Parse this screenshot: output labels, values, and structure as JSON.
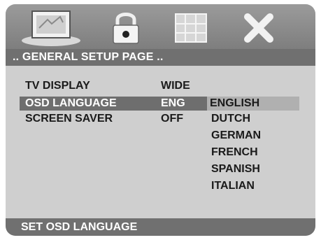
{
  "header": {
    "title": ".. GENERAL SETUP PAGE .."
  },
  "menu": {
    "items": [
      {
        "label": "TV DISPLAY",
        "value": "WIDE"
      },
      {
        "label": "OSD LANGUAGE",
        "value": "ENG"
      },
      {
        "label": "SCREEN SAVER",
        "value": "OFF"
      }
    ],
    "options": [
      "ENGLISH",
      "DUTCH",
      "GERMAN",
      "FRENCH",
      "SPANISH",
      "ITALIAN"
    ]
  },
  "footer": {
    "hint": "SET OSD LANGUAGE"
  },
  "icons": [
    "tv-icon",
    "lock-icon",
    "grid-icon",
    "close-icon"
  ]
}
